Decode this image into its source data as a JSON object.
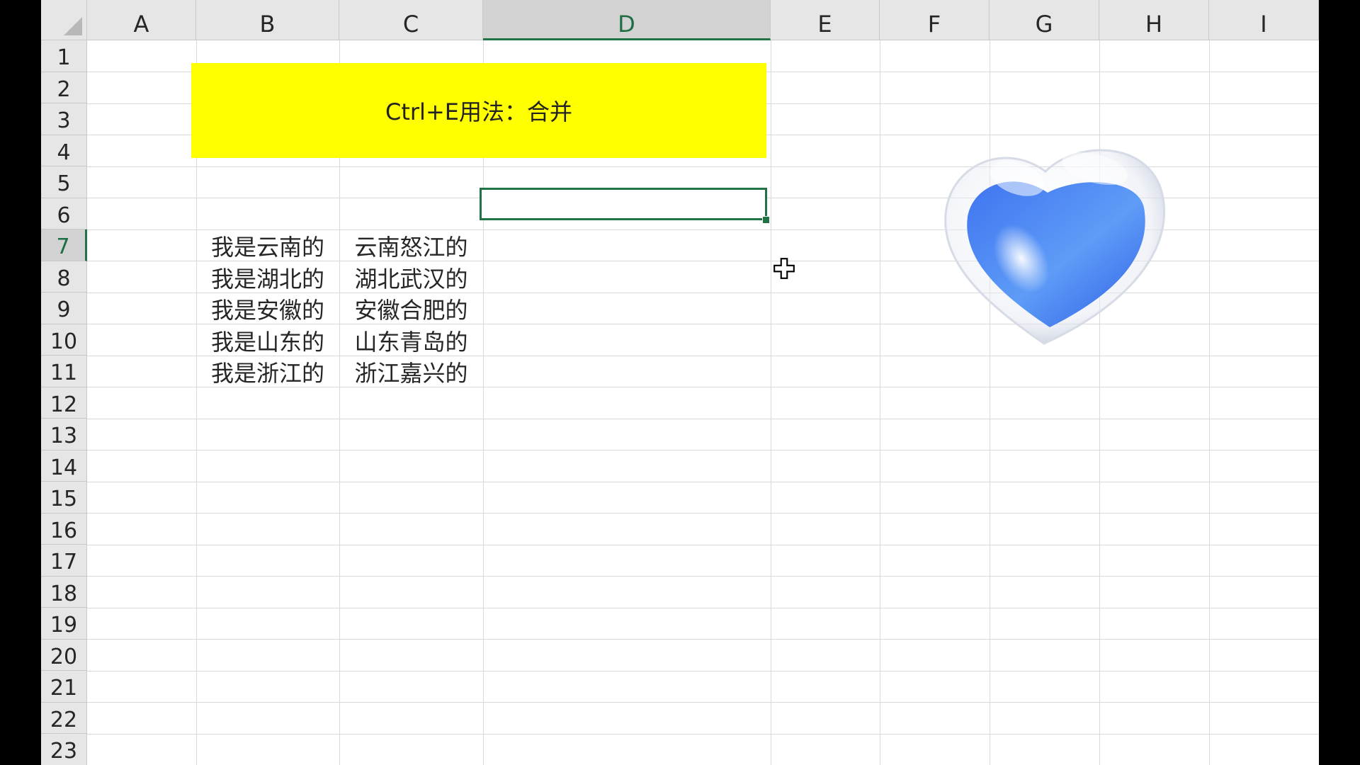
{
  "columns": [
    "A",
    "B",
    "C",
    "D",
    "E",
    "F",
    "G",
    "H",
    "I"
  ],
  "active_column": "D",
  "rows": [
    "1",
    "2",
    "3",
    "4",
    "5",
    "6",
    "7",
    "8",
    "9",
    "10",
    "11",
    "12",
    "13",
    "14",
    "15",
    "16",
    "17",
    "18",
    "19",
    "20",
    "21",
    "22",
    "23"
  ],
  "active_row": "7",
  "banner": {
    "text": "Ctrl+E用法：合并"
  },
  "column_b": [
    "我是云南的",
    "我是湖北的",
    "我是安徽的",
    "我是山东的",
    "我是浙江的"
  ],
  "column_c": [
    "云南怒江的",
    "湖北武汉的",
    "安徽合肥的",
    "山东青岛的",
    "浙江嘉兴的"
  ],
  "active_cell": {
    "ref": "D7",
    "value": ""
  },
  "colors": {
    "banner": "#ffff00",
    "selection": "#217346",
    "grid": "#d9d9d9",
    "header": "#e6e6e6"
  },
  "icons": {
    "cursor": "fill-cross-cursor-icon",
    "sticker": "blue-glass-heart"
  }
}
